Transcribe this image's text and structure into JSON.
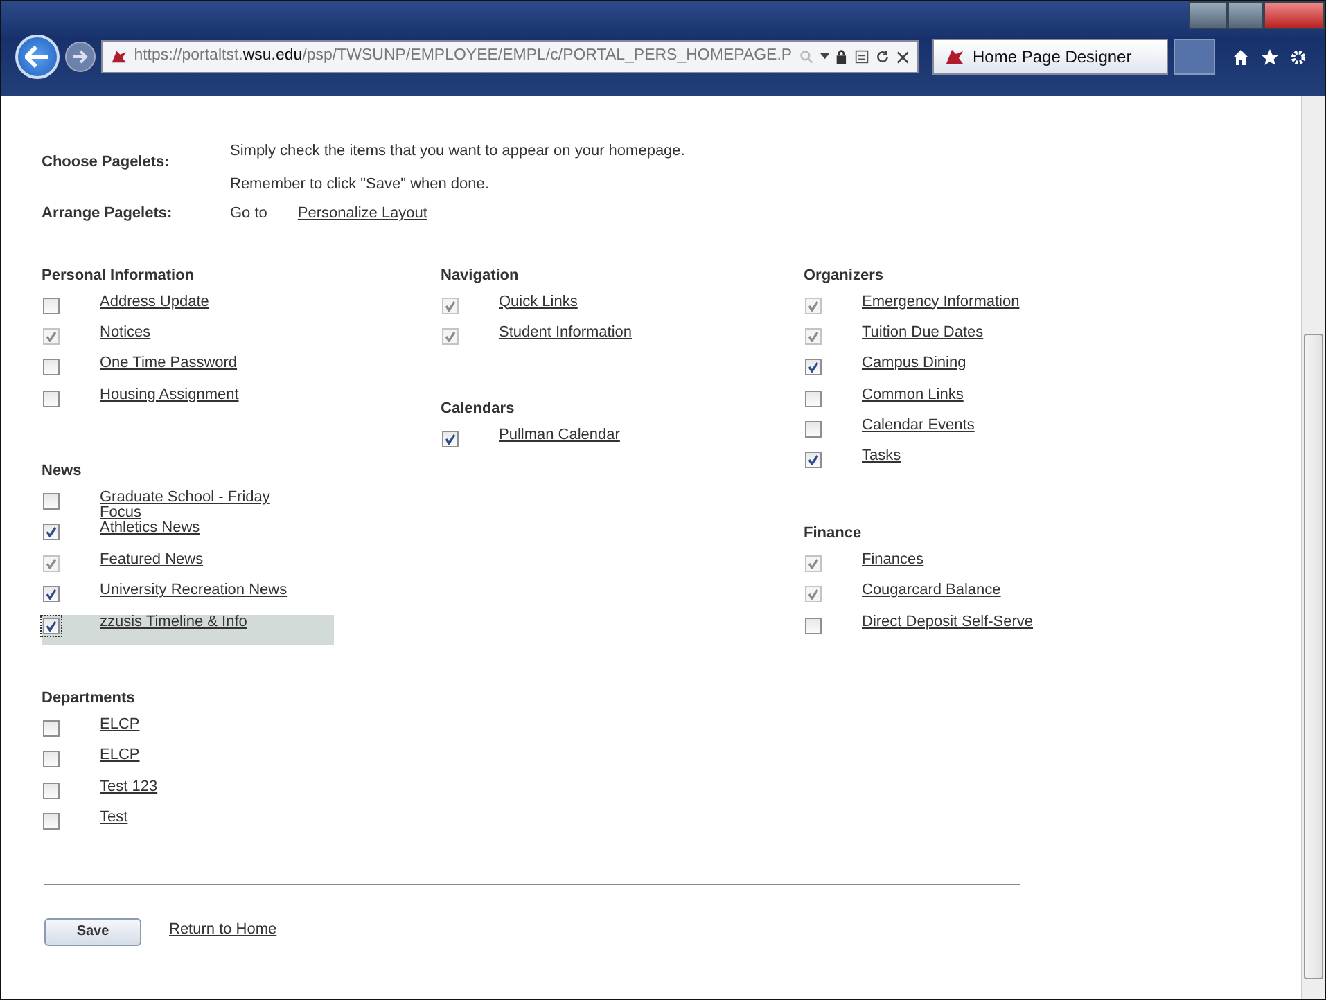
{
  "browser": {
    "url_prefix": "https://portaltst.",
    "url_host": "wsu.edu",
    "url_path": "/psp/TWSUNP/EMPLOYEE/EMPL/c/PORTAL_PERS_HOMEPAGE.P",
    "tab_title": "Home Page Designer"
  },
  "intro": [
    {
      "label": "Choose Pagelets:",
      "lines": [
        "Simply check the items that you want to appear on your homepage.",
        "Remember to click \"Save\" when done."
      ]
    },
    {
      "label": "Arrange Pagelets:",
      "goto": "Go to",
      "link": "Personalize Layout"
    }
  ],
  "columns": [
    {
      "sections": [
        {
          "title": "Personal Information",
          "items": [
            {
              "label": "Address Update",
              "checked": false,
              "disabled": false,
              "selected": false
            },
            {
              "label": "Notices",
              "checked": true,
              "disabled": true,
              "selected": false
            },
            {
              "label": "One Time Password",
              "checked": false,
              "disabled": false,
              "selected": false
            },
            {
              "label": "Housing Assignment",
              "checked": false,
              "disabled": false,
              "selected": false
            }
          ]
        },
        {
          "title": "News",
          "items": [
            {
              "label": "Graduate School - Friday Focus",
              "checked": false,
              "disabled": false,
              "selected": false
            },
            {
              "label": "Athletics News",
              "checked": true,
              "disabled": false,
              "selected": false
            },
            {
              "label": "Featured News",
              "checked": true,
              "disabled": true,
              "selected": false
            },
            {
              "label": "University Recreation News",
              "checked": true,
              "disabled": false,
              "selected": false
            },
            {
              "label": "zzusis Timeline & Info",
              "checked": true,
              "disabled": false,
              "selected": true
            }
          ]
        },
        {
          "title": "Departments",
          "items": [
            {
              "label": "ELCP",
              "checked": false,
              "disabled": false,
              "selected": false
            },
            {
              "label": "ELCP",
              "checked": false,
              "disabled": false,
              "selected": false
            },
            {
              "label": "Test 123",
              "checked": false,
              "disabled": false,
              "selected": false
            },
            {
              "label": "Test",
              "checked": false,
              "disabled": false,
              "selected": false
            }
          ]
        }
      ]
    },
    {
      "sections": [
        {
          "title": "Navigation",
          "items": [
            {
              "label": "Quick Links",
              "checked": true,
              "disabled": true,
              "selected": false
            },
            {
              "label": "Student Information",
              "checked": true,
              "disabled": true,
              "selected": false
            }
          ]
        },
        {
          "title": "Calendars",
          "items": [
            {
              "label": "Pullman Calendar",
              "checked": true,
              "disabled": false,
              "selected": false
            }
          ]
        }
      ]
    },
    {
      "sections": [
        {
          "title": "Organizers",
          "items": [
            {
              "label": "Emergency Information",
              "checked": true,
              "disabled": true,
              "selected": false
            },
            {
              "label": "Tuition Due Dates",
              "checked": true,
              "disabled": true,
              "selected": false
            },
            {
              "label": "Campus Dining",
              "checked": true,
              "disabled": false,
              "selected": false
            },
            {
              "label": "Common Links",
              "checked": false,
              "disabled": false,
              "selected": false
            },
            {
              "label": "Calendar Events",
              "checked": false,
              "disabled": false,
              "selected": false
            },
            {
              "label": "Tasks",
              "checked": true,
              "disabled": false,
              "selected": false
            }
          ]
        },
        {
          "title": "Finance",
          "items": [
            {
              "label": "Finances",
              "checked": true,
              "disabled": true,
              "selected": false
            },
            {
              "label": "Cougarcard Balance",
              "checked": true,
              "disabled": true,
              "selected": false
            },
            {
              "label": "Direct Deposit Self-Serve",
              "checked": false,
              "disabled": false,
              "selected": false
            }
          ]
        }
      ]
    }
  ],
  "footer": {
    "save": "Save",
    "link": "Return to Home"
  }
}
